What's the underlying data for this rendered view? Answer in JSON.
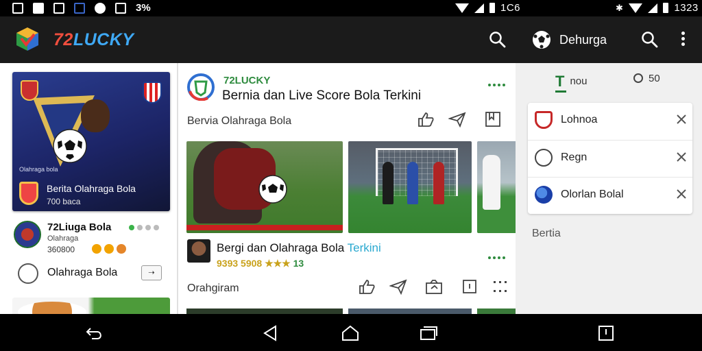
{
  "status_bar": {
    "battery_text": "3%",
    "time_mid": "1C6",
    "time_right": "1323",
    "icons": [
      "notification-icon",
      "image-icon",
      "mail-icon",
      "flag-icon",
      "chat-icon",
      "clipboard-icon"
    ]
  },
  "app": {
    "brand_prefix": "72",
    "brand_name": "LUCKY",
    "accent": "#3fa9f5",
    "green": "#2e8b3e"
  },
  "left_column": {
    "feature": {
      "tiny": "Olahraga bola",
      "title": "Berita Olahraga Bola",
      "subtitle": "700 baca"
    },
    "item1": {
      "title": "72Liuga Bola",
      "line1": "Olahraga",
      "line2": "360800"
    },
    "item2": {
      "title": "Olahraga Bola",
      "button": "⇢"
    }
  },
  "main": {
    "post1": {
      "brand": "72LUCKY",
      "title": "Bernia dan Live Score Bola Terkini",
      "category": "Bervia  Olahraga Bola"
    },
    "post2": {
      "title_main": "Bergi dan Olahraga Bola ",
      "title_highlight": "Terkini",
      "meta_prefix": "9393 5908 ★★★ ",
      "meta_count": "13",
      "category": "Orahgiram"
    }
  },
  "right_panel": {
    "title": "Dehurga",
    "tab1": "nou",
    "tab2": "50",
    "rows": [
      {
        "label": "Lohnoa",
        "icon": "club-crest-icon"
      },
      {
        "label": "Regn",
        "icon": "football-icon"
      },
      {
        "label": "Olorlan Bolal",
        "icon": "globe-icon"
      }
    ],
    "section": "Bertia"
  }
}
